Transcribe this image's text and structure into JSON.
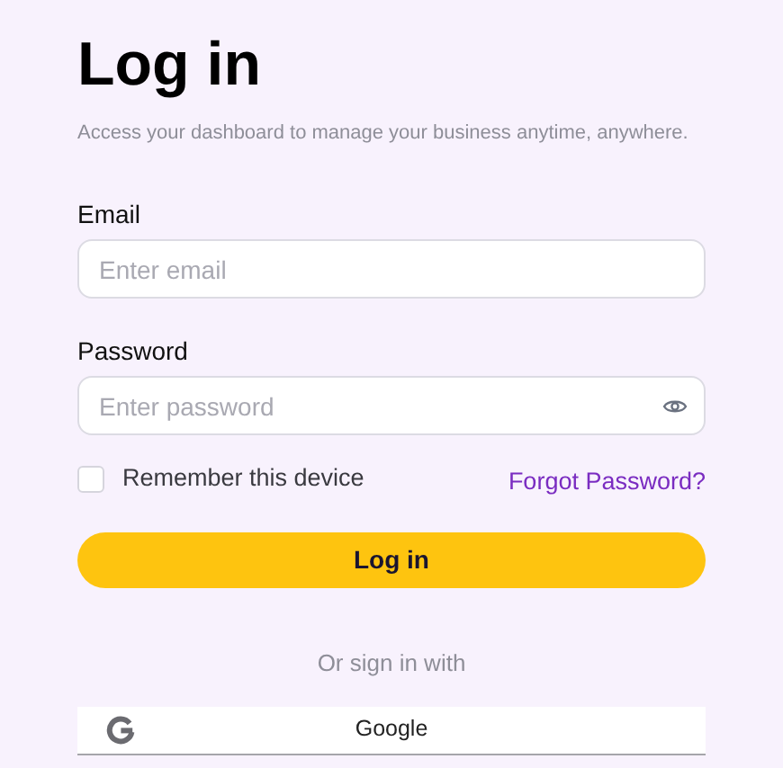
{
  "title": "Log in",
  "subtitle": "Access your dashboard to manage your business anytime, anywhere.",
  "fields": [
    {
      "label": "Email",
      "placeholder": "Enter email",
      "kind": "text"
    },
    {
      "label": "Password",
      "placeholder": "Enter password",
      "kind": "password"
    }
  ],
  "remember": {
    "label": "Remember this device",
    "checked": false
  },
  "forgot_link": "Forgot Password?",
  "submit": "Log in",
  "divider_text": "Or sign in with",
  "social": [
    {
      "label": "Google"
    }
  ]
}
